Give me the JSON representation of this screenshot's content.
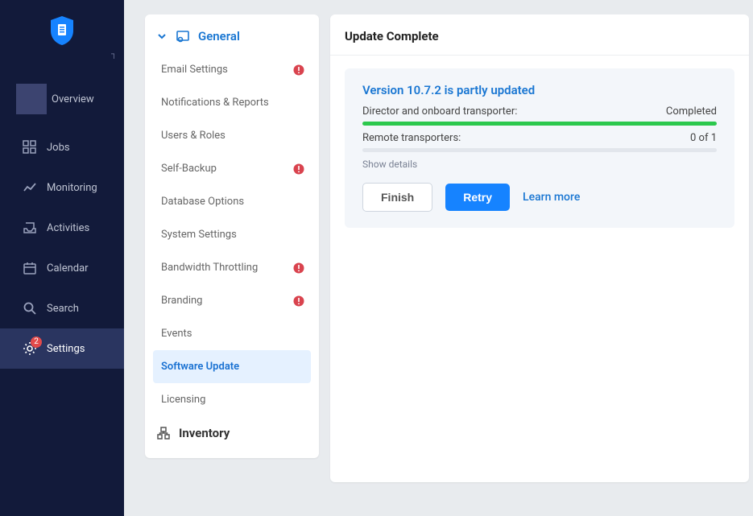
{
  "logo": {
    "name": "shield-logo"
  },
  "nav": {
    "items": [
      {
        "label": "Overview",
        "icon": "overview-icon"
      },
      {
        "label": "Jobs",
        "icon": "grid-icon"
      },
      {
        "label": "Monitoring",
        "icon": "chart-icon"
      },
      {
        "label": "Activities",
        "icon": "tray-icon"
      },
      {
        "label": "Calendar",
        "icon": "calendar-icon"
      },
      {
        "label": "Search",
        "icon": "search-icon"
      },
      {
        "label": "Settings",
        "icon": "gear-icon",
        "badge": "2"
      }
    ]
  },
  "settings_panel": {
    "section_general": {
      "label": "General",
      "items": [
        {
          "label": "Email Settings",
          "warn": true
        },
        {
          "label": "Notifications & Reports"
        },
        {
          "label": "Users & Roles"
        },
        {
          "label": "Self-Backup",
          "warn": true
        },
        {
          "label": "Database Options"
        },
        {
          "label": "System Settings"
        },
        {
          "label": "Bandwidth Throttling",
          "warn": true
        },
        {
          "label": "Branding",
          "warn": true
        },
        {
          "label": "Events"
        },
        {
          "label": "Software Update",
          "active": true
        },
        {
          "label": "Licensing"
        }
      ]
    },
    "section_inventory": {
      "label": "Inventory"
    }
  },
  "main": {
    "title": "Update Complete",
    "card": {
      "heading": "Version 10.7.2 is partly updated",
      "rows": [
        {
          "label": "Director and onboard transporter:",
          "value": "Completed",
          "done": true
        },
        {
          "label": "Remote transporters:",
          "value": "0 of 1",
          "done": false
        }
      ],
      "show_details": "Show details",
      "finish_label": "Finish",
      "retry_label": "Retry",
      "learn_label": "Learn more"
    }
  }
}
